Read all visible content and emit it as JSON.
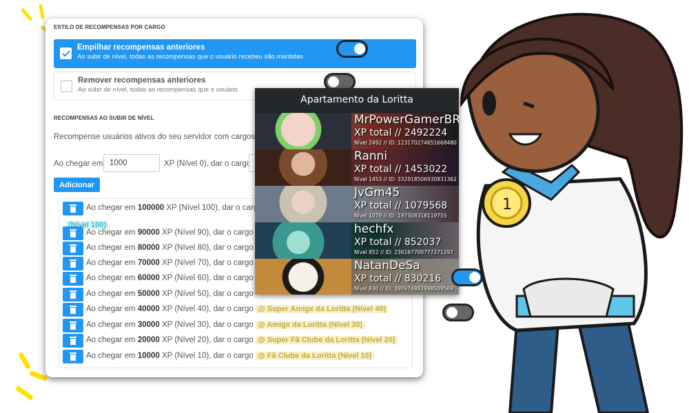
{
  "settings": {
    "style_title": "ESTILO DE RECOMPENSAS POR CARGO",
    "option_stack": {
      "title": "Empilhar recompensas anteriores",
      "desc": "Ao subir de nível, todas as recompensas que o usuário recebeu são mantidas",
      "checked": true
    },
    "option_remove": {
      "title": "Remover recompensas anteriores",
      "desc": "Ao subir de nível, todas as recompensas que o usuário",
      "checked": false
    }
  },
  "level_rewards": {
    "title": "RECOMPENSAS AO SUBIR DE NÍVEL",
    "description": "Recompense usuários ativos do seu servidor com cargos",
    "form": {
      "prefix": "Ao chegar em",
      "xp_value": "1000",
      "suffix": "XP (Nível 0), dar o cargo"
    },
    "add_button": "Adicionar",
    "items": [
      {
        "prefix": "Ao chegar em",
        "xp": "100000",
        "suffix": "XP (Nível 100), dar o cargo",
        "role": "(Nível 100)"
      },
      {
        "prefix": "Ao chegar em",
        "xp": "90000",
        "suffix": "XP (Nível 90), dar o cargo",
        "role": ""
      },
      {
        "prefix": "Ao chegar em",
        "xp": "80000",
        "suffix": "XP (Nível 80), dar o cargo",
        "role": ""
      },
      {
        "prefix": "Ao chegar em",
        "xp": "70000",
        "suffix": "XP (Nível 70), dar o cargo",
        "role": ""
      },
      {
        "prefix": "Ao chegar em",
        "xp": "60000",
        "suffix": "XP (Nível 60), dar o cargo",
        "role": ""
      },
      {
        "prefix": "Ao chegar em",
        "xp": "50000",
        "suffix": "XP (Nível 50), dar o cargo",
        "role": ""
      },
      {
        "prefix": "Ao chegar em",
        "xp": "40000",
        "suffix": "XP (Nível 40), dar o cargo",
        "role": "@ Super Amigx da Loritta (Nível 40)"
      },
      {
        "prefix": "Ao chegar em",
        "xp": "30000",
        "suffix": "XP (Nível 30), dar o cargo",
        "role": "@ Amigx da Loritta (Nível 30)"
      },
      {
        "prefix": "Ao chegar em",
        "xp": "20000",
        "suffix": "XP (Nível 20), dar o cargo",
        "role": "@ Super Fã Clube da Loritta (Nível 20)"
      },
      {
        "prefix": "Ao chegar em",
        "xp": "10000",
        "suffix": "XP (Nível 10), dar o cargo",
        "role": "@ Fã Clube da Loritta (Nível 10)"
      }
    ]
  },
  "leaderboard": {
    "title": "Apartamento da Loritta",
    "entries": [
      {
        "name": "MrPowerGamerBR",
        "xp": "XP total // 2492224",
        "meta": "Nível 2492 // ID: 123170274651668480",
        "color": "#f2d4c8",
        "accent": "#2b2f3a"
      },
      {
        "name": "Ranni",
        "xp": "XP total // 1453022",
        "meta": "Nível 1453 // ID: 332918506930831362",
        "color": "#6b3b2a",
        "accent": "#b2484a"
      },
      {
        "name": "JvGm45",
        "xp": "XP total // 1079568",
        "meta": "Nível 1079 // ID: 197308318119755",
        "color": "#a9b6c4",
        "accent": "#d8dde3"
      },
      {
        "name": "hechfx",
        "xp": "XP total // 852037",
        "meta": "Nível 852 // ID: 236167700777271297",
        "color": "#3b9a8f",
        "accent": "#1f5b52"
      },
      {
        "name": "NatanDeSa",
        "xp": "XP total // 830216",
        "meta": "Nível 830 // ID: 390976882998509569",
        "color": "#f5f1e8",
        "accent": "#c28a3a"
      }
    ]
  },
  "colors": {
    "primary": "#2196f3",
    "role_tag": "#c8a93a",
    "teal_tag": "#40b8c2"
  }
}
